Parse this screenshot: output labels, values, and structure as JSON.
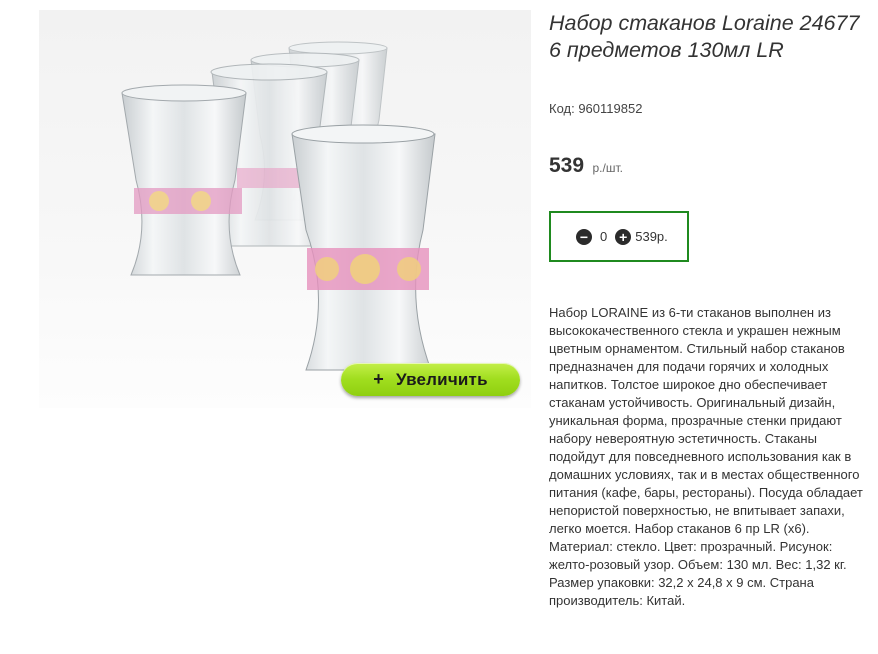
{
  "product": {
    "title": "Набор стаканов Loraine 24677 6 предметов 130мл LR",
    "code": "Код: 960119852",
    "price_amount": "539",
    "price_unit": "р./шт.",
    "description": "Набор LORAINE из 6-ти стаканов выполнен из высококачественного стекла и украшен нежным цветным орнаментом. Стильный набор стаканов предназначен для подачи горячих и холодных напитков. Толстое широкое дно обеспечивает стаканам устойчивость. Оригинальный дизайн, уникальная форма, прозрачные стенки придают набору невероятную эстетичность. Стаканы подойдут для повседневного использования как в домашних условиях, так и в местах общественного питания (кафе, бары, рестораны). Посуда обладает непористой поверхностью, не впитывает запахи, легко моется. Набор стаканов 6 пр LR (х6). Материал: стекло. Цвет: прозрачный. Рисунок: желто-розовый узор. Объем: 130 мл. Вес: 1,32 кг. Размер упаковки: 32,2 х 24,8 х 9 см. Страна производитель: Китай."
  },
  "image": {
    "zoom_icon": "+",
    "zoom_label": "Увеличить"
  },
  "quantity": {
    "minus_icon": "−",
    "plus_icon": "+",
    "value": "0",
    "total": "539р."
  },
  "colors": {
    "accent_green": "#1f8a1f",
    "zoom_button": "#a1de1f",
    "pattern_pink": "#e07ab2",
    "pattern_yellow": "#e8c25a"
  }
}
